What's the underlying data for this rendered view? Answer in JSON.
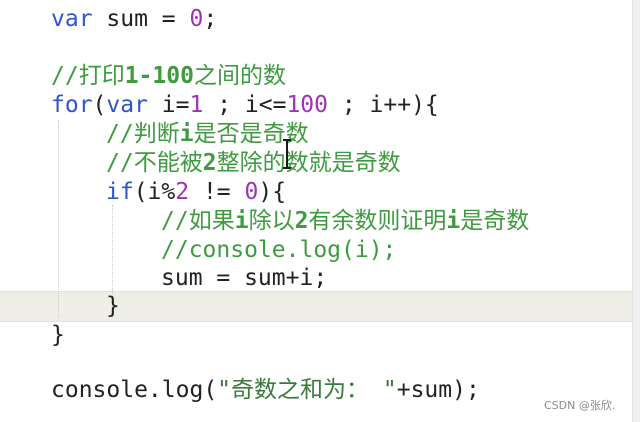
{
  "code": {
    "l1": {
      "kw": "var",
      "rest": " sum = ",
      "num": "0",
      "end": ";"
    },
    "l3": {
      "a": "//打印",
      "b": "1-100",
      "c": "之间的数"
    },
    "l4": {
      "kw1": "for",
      "p1": "(",
      "kw2": "var",
      "p2": " i=",
      "n1": "1",
      "p3": " ; i<=",
      "n2": "100",
      "p4": " ; i++){"
    },
    "l5": {
      "a": "//判断",
      "b": "i",
      "c": "是否是奇数"
    },
    "l6": {
      "a": "//不能被",
      "b": "2",
      "c": "整除的数就是奇数"
    },
    "l7": {
      "kw": "if",
      "a": "(i%",
      "n1": "2",
      "b": " != ",
      "n2": "0",
      "c": "){"
    },
    "l8": {
      "a": "//如果",
      "b": "i",
      "c": "除以",
      "d": "2",
      "e": "有余数则证明",
      "f": "i",
      "g": "是奇数"
    },
    "l9": {
      "text": "//console.log(i);"
    },
    "l10": {
      "text": "sum = sum+i;"
    },
    "l11": {
      "text": "}"
    },
    "l12": {
      "text": "}"
    },
    "l14": {
      "a": "console.log(",
      "s": "\"奇数之和为： \"",
      "b": "+sum);"
    }
  },
  "watermark": "CSDN @张欣."
}
